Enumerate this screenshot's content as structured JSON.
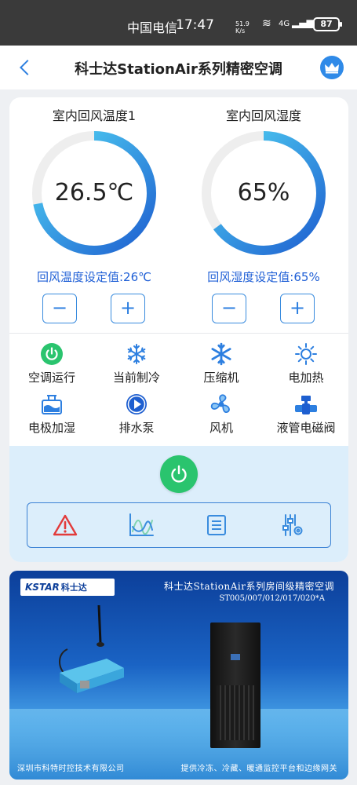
{
  "status_bar": {
    "carrier": "中国电信",
    "time": "17:47",
    "net_speed": "51.9 K/s",
    "network": "4G",
    "battery": "87"
  },
  "nav": {
    "title": "科士达StationAir系列精密空调"
  },
  "gauges": {
    "temperature": {
      "title": "室内回风温度1",
      "value": "26.5℃",
      "fill_fraction": 0.72,
      "setpoint_label": "回风温度设定值:26℃"
    },
    "humidity": {
      "title": "室内回风湿度",
      "value": "65%",
      "fill_fraction": 0.65,
      "setpoint_label": "回风湿度设定值:65%"
    }
  },
  "stepper_labels": {
    "minus": "−",
    "plus": "+"
  },
  "status_items": [
    {
      "label": "空调运行",
      "icon": "power-running-icon"
    },
    {
      "label": "当前制冷",
      "icon": "snowflake-icon"
    },
    {
      "label": "压缩机",
      "icon": "compressor-snowflake-icon"
    },
    {
      "label": "电加热",
      "icon": "sun-heater-icon"
    },
    {
      "label": "电极加湿",
      "icon": "humidifier-icon"
    },
    {
      "label": "排水泵",
      "icon": "pump-play-icon"
    },
    {
      "label": "风机",
      "icon": "fan-icon"
    },
    {
      "label": "液管电磁阀",
      "icon": "valve-icon"
    }
  ],
  "tools": [
    "alarm-icon",
    "trend-chart-icon",
    "list-icon",
    "settings-sliders-icon"
  ],
  "banner": {
    "logo_text": "KSTAR",
    "logo_cn": "科士达",
    "title": "科士达StationAir系列房间级精密空调",
    "model": "ST005/007/012/017/020*A",
    "footer_left": "深圳市科特时控技术有限公司",
    "footer_right": "提供冷冻、冷藏、暖通监控平台和边缘网关"
  },
  "colors": {
    "accent": "#2d7fe0",
    "gauge_start": "#1e5fd0",
    "gauge_end": "#52d6f4",
    "running_green": "#2ac46e",
    "alarm_red": "#e23b3b",
    "panel_blue": "#dceefb"
  }
}
